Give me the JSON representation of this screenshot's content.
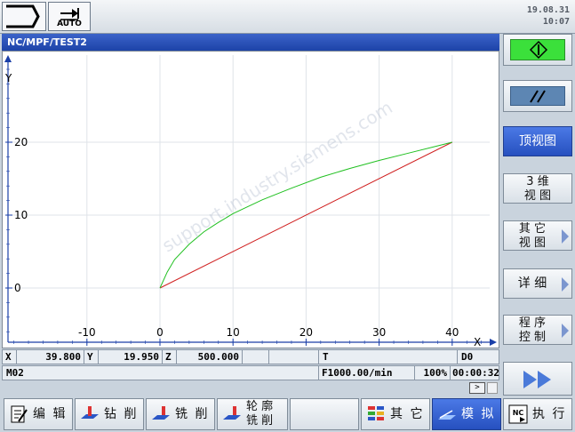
{
  "header": {
    "mode_label": "AUTO",
    "date": "19.08.31",
    "time": "10:07"
  },
  "window": {
    "title": "NC/MPF/TEST2"
  },
  "chart_data": {
    "type": "line",
    "xlabel": "X",
    "ylabel": "Y",
    "xlim": [
      -21,
      46
    ],
    "ylim": [
      -8,
      31
    ],
    "x_ticks": [
      -10,
      0,
      10,
      20,
      30,
      40
    ],
    "y_ticks": [
      0,
      10,
      20
    ],
    "series": [
      {
        "color": "#d02020",
        "x": [
          0,
          40
        ],
        "y": [
          0,
          20
        ]
      },
      {
        "color": "#20c020",
        "x": [
          0,
          1,
          2,
          4,
          6,
          8,
          10,
          14,
          18,
          22,
          26,
          30,
          34,
          38,
          40
        ],
        "y": [
          0,
          2.2,
          3.9,
          6.0,
          7.7,
          9.0,
          10.2,
          12.1,
          13.7,
          15.2,
          16.4,
          17.5,
          18.5,
          19.5,
          20
        ]
      }
    ]
  },
  "status": {
    "x_label": "X",
    "x_value": "39.800",
    "y_label": "Y",
    "y_value": "19.950",
    "z_label": "Z",
    "z_value": "500.000",
    "t_label": "T",
    "d_label": "D0",
    "program_line": "M02",
    "feed": "F1000.00/min",
    "override": "100%",
    "runtime": "00:00:32",
    "arrow": ">"
  },
  "vsoftkeys": {
    "top_view": "顶视图",
    "view3d_1": "3 维",
    "view3d_2": "视 图",
    "other_1": "其 它",
    "other_2": "视 图",
    "detail": "详 细",
    "prog_1": "程 序",
    "prog_2": "控 制"
  },
  "hsoftkeys": {
    "edit": "编 辑",
    "drill": "钻 削",
    "mill": "铣 削",
    "contour_1": "轮 廓",
    "contour_2": "铣 削",
    "other": "其 它",
    "simulate": "模 拟",
    "execute": "执 行",
    "nc_icon_text": "NC"
  },
  "colors": {
    "accent": "#2a56c6",
    "cycle_start": "#3be03b"
  }
}
